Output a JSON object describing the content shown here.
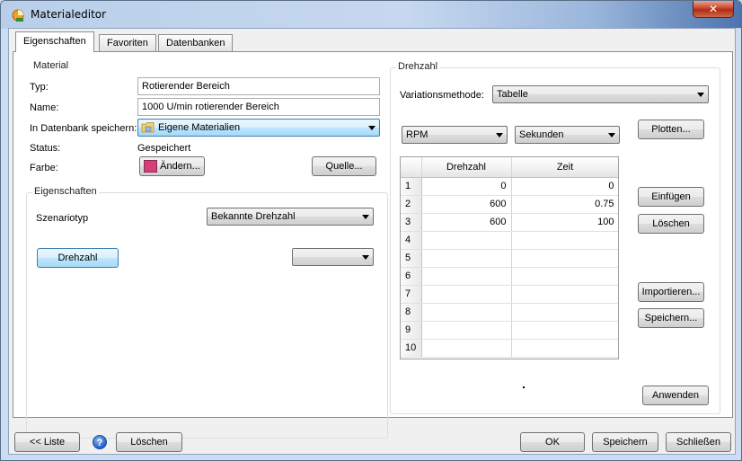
{
  "window": {
    "title": "Materialeditor",
    "close_label": "✕"
  },
  "tabs": [
    {
      "label": "Eigenschaften",
      "active": true
    },
    {
      "label": "Favoriten",
      "active": false
    },
    {
      "label": "Datenbanken",
      "active": false
    }
  ],
  "material": {
    "group_title": "Material",
    "typ_label": "Typ:",
    "typ_value": "Rotierender Bereich",
    "name_label": "Name:",
    "name_value": "1000 U/min rotierender Bereich",
    "db_label": "In Datenbank speichern:",
    "db_value": "Eigene Materialien",
    "status_label": "Status:",
    "status_value": "Gespeichert",
    "farbe_label": "Farbe:",
    "farbe_color": "#d63e7a",
    "aendern_label": "Ändern...",
    "quelle_label": "Quelle..."
  },
  "eigenschaften": {
    "group_title": "Eigenschaften",
    "szenariotyp_label": "Szenariotyp",
    "szenariotyp_value": "Bekannte Drehzahl",
    "drehzahl_button": "Drehzahl",
    "empty_combo_value": ""
  },
  "drehzahl": {
    "group_title": "Drehzahl",
    "variationsmethode_label": "Variationsmethode:",
    "variationsmethode_value": "Tabelle",
    "unit_value": "RPM",
    "time_unit_value": "Sekunden",
    "plotten_label": "Plotten...",
    "einfuegen_label": "Einfügen",
    "loeschen_label": "Löschen",
    "importieren_label": "Importieren...",
    "speichern_label": "Speichern...",
    "anwenden_label": "Anwenden",
    "table": {
      "columns": [
        "Drehzahl",
        "Zeit"
      ],
      "rows": [
        {
          "n": "1",
          "drehzahl": "0",
          "zeit": "0"
        },
        {
          "n": "2",
          "drehzahl": "600",
          "zeit": "0.75"
        },
        {
          "n": "3",
          "drehzahl": "600",
          "zeit": "100"
        },
        {
          "n": "4",
          "drehzahl": "",
          "zeit": ""
        },
        {
          "n": "5",
          "drehzahl": "",
          "zeit": ""
        },
        {
          "n": "6",
          "drehzahl": "",
          "zeit": ""
        },
        {
          "n": "7",
          "drehzahl": "",
          "zeit": ""
        },
        {
          "n": "8",
          "drehzahl": "",
          "zeit": ""
        },
        {
          "n": "9",
          "drehzahl": "",
          "zeit": ""
        },
        {
          "n": "10",
          "drehzahl": "",
          "zeit": ""
        }
      ]
    }
  },
  "footer": {
    "liste_label": "<< Liste",
    "help_label": "?",
    "loeschen_label": "Löschen",
    "ok_label": "OK",
    "speichern_label": "Speichern",
    "schliessen_label": "Schließen"
  }
}
